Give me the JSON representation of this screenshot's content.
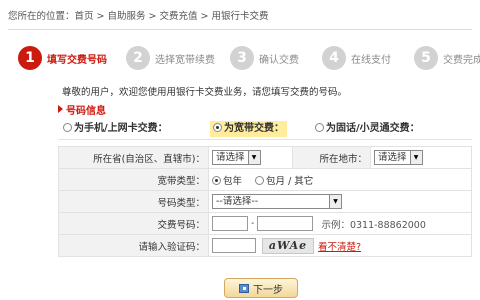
{
  "breadcrumb": {
    "text": "您所在的位置：首页 > 自助服务 > 交费充值 > 用银行卡交费"
  },
  "steps": [
    {
      "num": "1",
      "label": "填写交费号码",
      "active": true
    },
    {
      "num": "2",
      "label": "选择宽带续费",
      "active": false
    },
    {
      "num": "3",
      "label": "确认交费",
      "active": false
    },
    {
      "num": "4",
      "label": "在线支付",
      "active": false
    },
    {
      "num": "5",
      "label": "交费完成",
      "active": false
    }
  ],
  "intro": "尊敬的用户，欢迎您使用用银行卡交费业务，请您填写交费的号码。",
  "section_title": "号码信息",
  "payment_types": {
    "mobile": "为手机/上网卡交费：",
    "broadband": "为宽带交费：",
    "fixed": "为固话/小灵通交费：",
    "selected": "broadband"
  },
  "form": {
    "province_label": "所在省(自治区、直辖市)：",
    "province_value": "请选择",
    "city_label": "所在地市：",
    "city_value": "请选择",
    "bb_type_label": "宽带类型：",
    "bb_type_opt1": "包年",
    "bb_type_opt2": "包月 / 其它",
    "number_type_label": "号码类型：",
    "number_type_value": "--请选择--",
    "number_label": "交费号码：",
    "number_hint": "示例：0311-88862000",
    "captcha_label": "请输入验证码：",
    "captcha_text": "aWAe",
    "refresh_link": "看不清楚?"
  },
  "next_button": "下一步",
  "colors": {
    "accent": "#cc1a0e",
    "highlight": "#ffec9c"
  }
}
